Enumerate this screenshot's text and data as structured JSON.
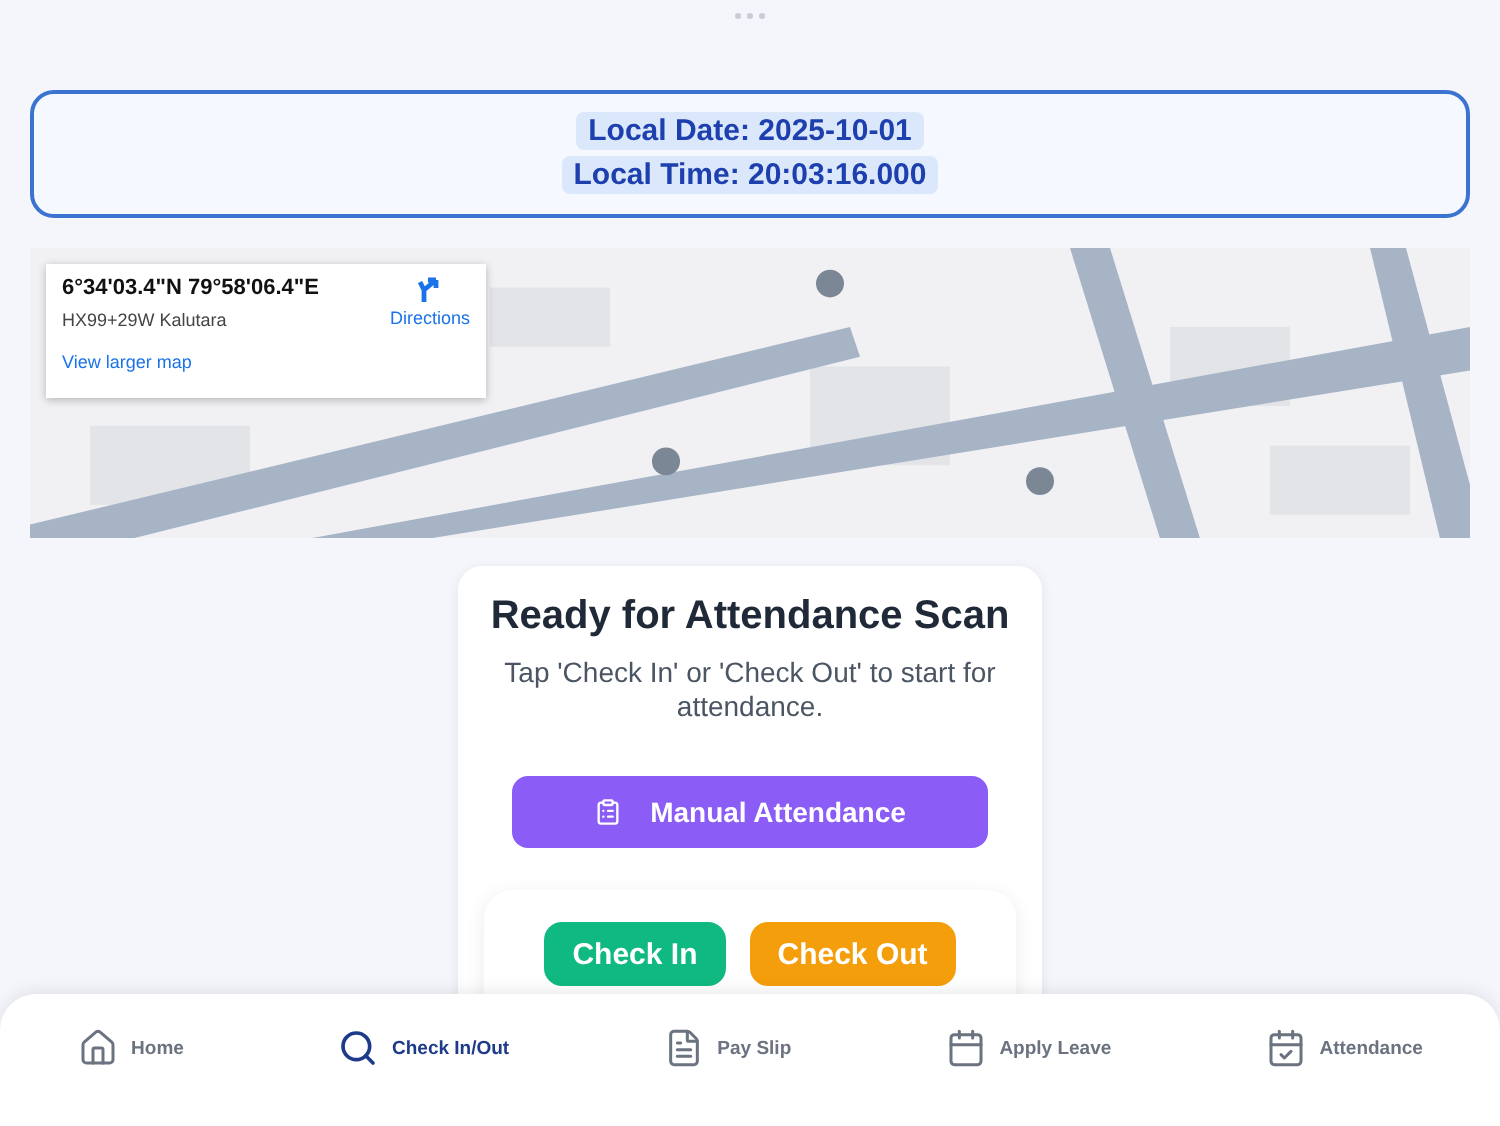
{
  "datetime": {
    "date": "Local Date: 2025-10-01",
    "time": "Local Time: 20:03:16.000"
  },
  "map": {
    "kind": "picture",
    "info": {
      "coordinates": "6°34'03.4\"N 79°58'06.4\"E",
      "plus_code": "HX99+29W Kalutara",
      "directions": "Directions",
      "larger_map": "View larger map"
    }
  },
  "scan_card": {
    "title": "Ready for Attendance Scan",
    "subtitle": "Tap 'Check In' or 'Check Out' to start for attendance.",
    "manual_button": "Manual Attendance",
    "check_in": "Check In",
    "check_out": "Check Out"
  },
  "nav": [
    {
      "label": "Home",
      "selected": false
    },
    {
      "label": "Check In/Out",
      "selected": true
    },
    {
      "label": "Pay Slip",
      "selected": false
    },
    {
      "label": "Apply Leave",
      "selected": false
    },
    {
      "label": "Attendance",
      "selected": false
    }
  ]
}
